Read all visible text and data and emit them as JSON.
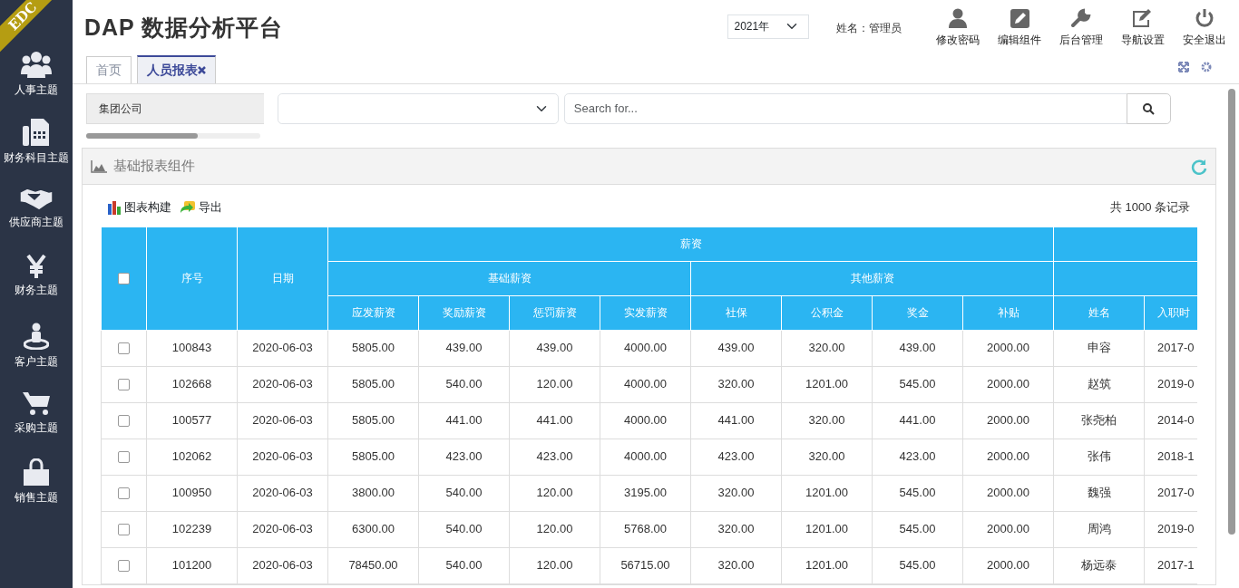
{
  "brand_ribbon": "EDC",
  "sidebar": {
    "items": [
      {
        "label": "人事主题"
      },
      {
        "label": "财务科目主题"
      },
      {
        "label": "供应商主题"
      },
      {
        "label": "财务主题"
      },
      {
        "label": "客户主题"
      },
      {
        "label": "采购主题"
      },
      {
        "label": "销售主题"
      }
    ]
  },
  "header": {
    "title": "DAP 数据分析平台",
    "year_select": "2021年",
    "user": "姓名：管理员",
    "actions": [
      "修改密码",
      "编辑组件",
      "后台管理",
      "导航设置",
      "安全退出"
    ]
  },
  "tabs": [
    {
      "label": "首页",
      "selected": false,
      "closable": false
    },
    {
      "label": "人员报表",
      "selected": true,
      "closable": true
    }
  ],
  "filters": {
    "company": "集团公司",
    "search_placeholder": "Search for..."
  },
  "panel": {
    "title": "基础报表组件",
    "toolbar": [
      "图表构建",
      "导出"
    ],
    "record_count": "共 1000 条记录"
  },
  "table": {
    "group_header": "薪资",
    "subgroups": [
      "基础薪资",
      "其他薪资"
    ],
    "select_all_checked": false,
    "columns": [
      "序号",
      "日期",
      "应发薪资",
      "奖励薪资",
      "惩罚薪资",
      "实发薪资",
      "社保",
      "公积金",
      "奖金",
      "补贴",
      "姓名",
      "入职时"
    ],
    "rows": [
      {
        "checked": false,
        "cells": [
          "100843",
          "2020-06-03",
          "5805.00",
          "439.00",
          "439.00",
          "4000.00",
          "439.00",
          "320.00",
          "439.00",
          "2000.00",
          "申容",
          "2017-0"
        ]
      },
      {
        "checked": false,
        "cells": [
          "102668",
          "2020-06-03",
          "5805.00",
          "540.00",
          "120.00",
          "4000.00",
          "320.00",
          "1201.00",
          "545.00",
          "2000.00",
          "赵筑",
          "2019-0"
        ]
      },
      {
        "checked": false,
        "cells": [
          "100577",
          "2020-06-03",
          "5805.00",
          "441.00",
          "441.00",
          "4000.00",
          "441.00",
          "320.00",
          "441.00",
          "2000.00",
          "张尧柏",
          "2014-0"
        ]
      },
      {
        "checked": false,
        "cells": [
          "102062",
          "2020-06-03",
          "5805.00",
          "423.00",
          "423.00",
          "4000.00",
          "423.00",
          "320.00",
          "423.00",
          "2000.00",
          "张伟",
          "2018-1"
        ]
      },
      {
        "checked": false,
        "cells": [
          "100950",
          "2020-06-03",
          "3800.00",
          "540.00",
          "120.00",
          "3195.00",
          "320.00",
          "1201.00",
          "545.00",
          "2000.00",
          "魏强",
          "2017-0"
        ]
      },
      {
        "checked": false,
        "cells": [
          "102239",
          "2020-06-03",
          "6300.00",
          "540.00",
          "120.00",
          "5768.00",
          "320.00",
          "1201.00",
          "545.00",
          "2000.00",
          "周鸿",
          "2019-0"
        ]
      },
      {
        "checked": false,
        "cells": [
          "101200",
          "2020-06-03",
          "78450.00",
          "540.00",
          "120.00",
          "56715.00",
          "320.00",
          "1201.00",
          "545.00",
          "2000.00",
          "杨远泰",
          "2017-1"
        ]
      }
    ]
  }
}
